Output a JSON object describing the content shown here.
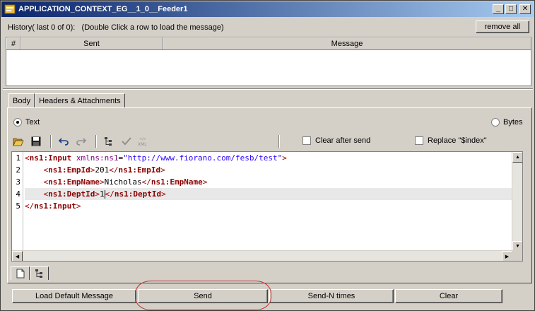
{
  "window": {
    "title": "APPLICATION_CONTEXT_EG__1_0__Feeder1",
    "minimize_glyph": "_",
    "maximize_glyph": "□",
    "close_glyph": "✕"
  },
  "history": {
    "label": "History( last 0 of 0):   (Double Click a row to load the message)",
    "remove_all_label": "remove all",
    "columns": [
      "#",
      "Sent",
      "Message"
    ]
  },
  "tabs": [
    "Body",
    "Headers & Attachments"
  ],
  "format": {
    "text_label": "Text",
    "bytes_label": "Bytes",
    "selected": "Text"
  },
  "toolbar": {
    "clear_after_send_label": "Clear after send",
    "replace_index_label": "Replace \"$index\"",
    "icons": [
      "open-folder-icon",
      "save-icon",
      "undo-icon",
      "redo-icon",
      "tree-icon",
      "validate-icon",
      "xml-icon"
    ]
  },
  "editor": {
    "line_numbers": [
      "1",
      "2",
      "3",
      "4",
      "5"
    ],
    "lines": [
      {
        "indent": "",
        "open": "ns1:Input",
        "attr": "xmlns:ns1",
        "val": "\"http://www.fiorano.com/fesb/test\""
      },
      {
        "indent": "    ",
        "open": "ns1:EmpId",
        "text": "201",
        "close": "ns1:EmpId"
      },
      {
        "indent": "    ",
        "open": "ns1:EmpName",
        "text": "Nicholas",
        "close": "ns1:EmpName"
      },
      {
        "indent": "    ",
        "open": "ns1:DeptId",
        "text": "1",
        "close": "ns1:DeptId"
      },
      {
        "indent": "",
        "close_only": "ns1:Input"
      }
    ],
    "highlighted_line": 4
  },
  "bottom_buttons": {
    "load_default": "Load Default Message",
    "send": "Send",
    "send_n": "Send-N times",
    "clear": "Clear"
  },
  "colors": {
    "title_start": "#0a246a",
    "title_end": "#a6caf0",
    "annotation_circle": "#c0302e"
  }
}
